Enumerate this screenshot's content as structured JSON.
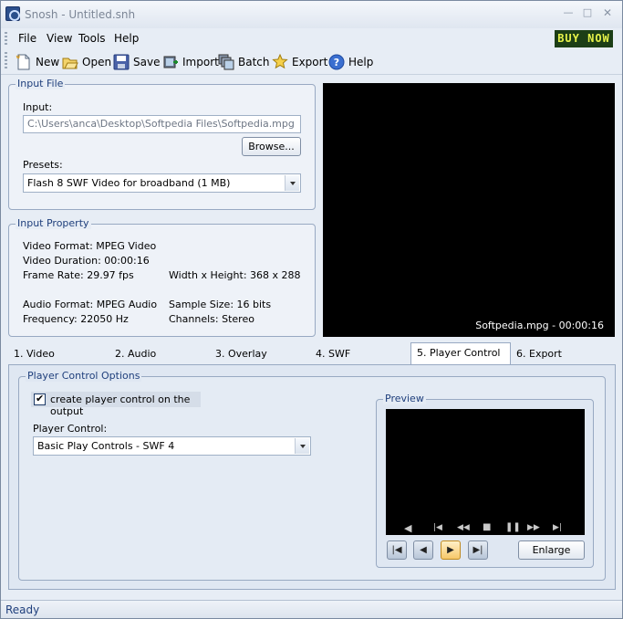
{
  "window": {
    "title": "Snosh - Untitled.snh"
  },
  "menu": {
    "file": "File",
    "view": "View",
    "tools": "Tools",
    "help": "Help",
    "buynow": "BUY NOW"
  },
  "toolbar": {
    "new": "New",
    "open": "Open",
    "save": "Save",
    "import": "Import",
    "batch": "Batch",
    "export": "Export",
    "help": "Help"
  },
  "input_file": {
    "legend": "Input File",
    "input_label": "Input:",
    "input_value": "C:\\Users\\anca\\Desktop\\Softpedia Files\\Softpedia.mpg",
    "browse": "Browse...",
    "presets_label": "Presets:",
    "presets_value": "Flash 8 SWF Video for broadband (1 MB)"
  },
  "input_property": {
    "legend": "Input Property",
    "video_format": "Video Format: MPEG Video",
    "video_duration": "Video Duration: 00:00:16",
    "frame_rate": "Frame Rate: 29.97 fps",
    "width_height": "Width x Height: 368 x 288",
    "audio_format": "Audio Format: MPEG Audio",
    "sample_size": "Sample Size: 16 bits",
    "frequency": "Frequency: 22050 Hz",
    "channels": "Channels: Stereo"
  },
  "video": {
    "caption": "Softpedia.mpg - 00:00:16"
  },
  "tabs": [
    "1. Video",
    "2. Audio",
    "3. Overlay",
    "4. SWF",
    "5. Player Control",
    "6. Export"
  ],
  "player_control": {
    "legend": "Player Control Options",
    "checkbox_label": "create player control on the output",
    "checkbox_checked": true,
    "control_label": "Player Control:",
    "control_value": "Basic Play Controls - SWF 4"
  },
  "preview": {
    "legend": "Preview",
    "enlarge": "Enlarge"
  },
  "status": {
    "text": "Ready"
  }
}
